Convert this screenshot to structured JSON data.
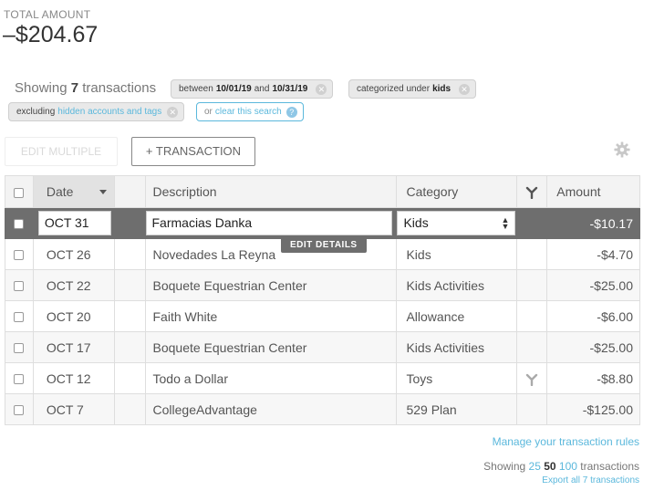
{
  "total": {
    "label": "TOTAL AMOUNT",
    "value": "–$204.67"
  },
  "summary": {
    "prefix": "Showing",
    "count": "7",
    "suffix": "transactions"
  },
  "filters": {
    "date": {
      "prefix": "between",
      "start": "10/01/19",
      "mid": "and",
      "end": "10/31/19"
    },
    "category": {
      "prefix": "categorized under",
      "value": "kids"
    },
    "excluding": {
      "prefix": "excluding",
      "link": "hidden accounts and tags"
    },
    "clear": {
      "prefix": "or",
      "link": "clear this search"
    }
  },
  "toolbar": {
    "edit_multiple": "EDIT MULTIPLE",
    "add_transaction": "+ TRANSACTION"
  },
  "table": {
    "headers": {
      "date": "Date",
      "description": "Description",
      "category": "Category",
      "amount": "Amount"
    },
    "selected": {
      "date": "OCT 31",
      "description": "Farmacias Danka",
      "category": "Kids",
      "amount": "-$10.17"
    },
    "edit_details": "EDIT DETAILS",
    "rows": [
      {
        "date": "OCT 26",
        "description": "Novedades La Reyna",
        "category": "Kids",
        "amount": "-$4.70"
      },
      {
        "date": "OCT 22",
        "description": "Boquete Equestrian Center",
        "category": "Kids Activities",
        "amount": "-$25.00"
      },
      {
        "date": "OCT 20",
        "description": "Faith White",
        "category": "Allowance",
        "amount": "-$6.00"
      },
      {
        "date": "OCT 17",
        "description": "Boquete Equestrian Center",
        "category": "Kids Activities",
        "amount": "-$25.00"
      },
      {
        "date": "OCT 12",
        "description": "Todo a Dollar",
        "category": "Toys",
        "amount": "-$8.80"
      },
      {
        "date": "OCT 7",
        "description": "CollegeAdvantage",
        "category": "529 Plan",
        "amount": "-$125.00"
      }
    ]
  },
  "footer": {
    "manage_rules": "Manage your transaction rules",
    "pager": {
      "prefix": "Showing",
      "opt1": "25",
      "opt2": "50",
      "opt3": "100",
      "suffix": "transactions"
    },
    "export": "Export all 7 transactions"
  },
  "colors": {
    "accent": "#5bb8dc",
    "selected_row": "#6e6e6e"
  }
}
